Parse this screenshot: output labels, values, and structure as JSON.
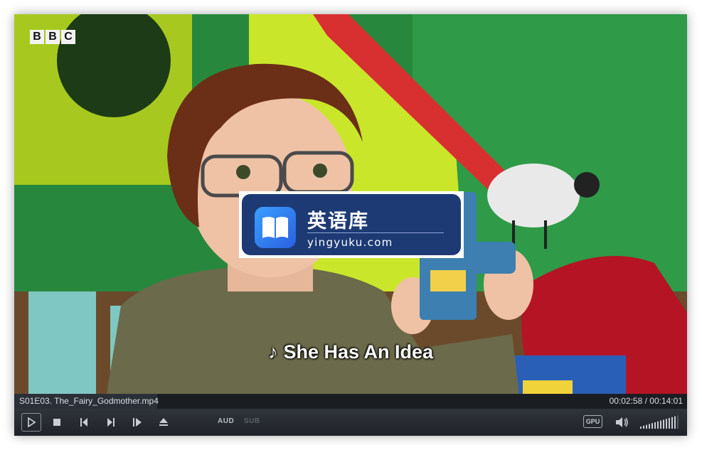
{
  "overlay": {
    "channel_logo": [
      "B",
      "B",
      "C"
    ],
    "watermark_title": "英语库",
    "watermark_url": "yingyuku.com",
    "subtitle_note": "♪",
    "subtitle_text": "She Has An Idea"
  },
  "status": {
    "filename": "S01E03. The_Fairy_Godmother.mp4",
    "time": "00:02:58 / 00:14:01",
    "progress": 0.212
  },
  "controls": {
    "audio_label": "AUD",
    "subtitle_label": "SUB",
    "gpu_label": "GPU",
    "icons": [
      "play-icon",
      "stop-icon",
      "previous-icon",
      "next-icon",
      "frame-step-icon",
      "eject-icon",
      "volume-icon"
    ],
    "volume_level": 0.9
  },
  "colors": {
    "bar_bg": "#1a1d21",
    "controls_bg": "#2a2e34",
    "watermark_bg": "#1d3a75"
  }
}
